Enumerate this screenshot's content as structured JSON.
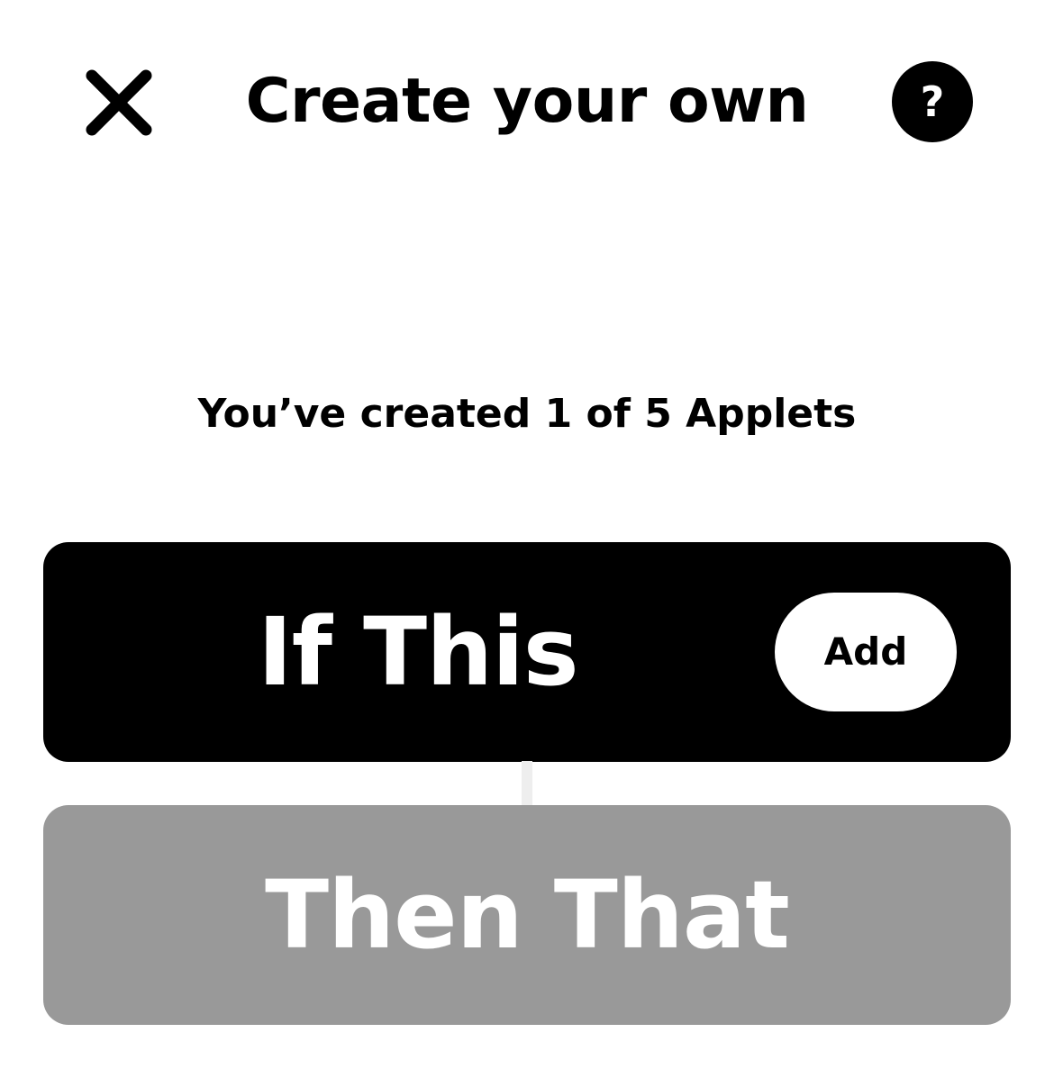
{
  "header": {
    "title": "Create your own",
    "close_icon": "close-icon",
    "help_label": "?",
    "help_icon": "question-mark-icon"
  },
  "applet_count": {
    "text": "You’ve created 1 of 5 Applets",
    "created": 1,
    "limit": 5
  },
  "trigger": {
    "label": "If This",
    "add_label": "Add",
    "color": "#000000"
  },
  "action": {
    "label": "Then That",
    "color": "#999999",
    "state": "disabled"
  },
  "colors": {
    "connector": "#eeeeee",
    "text": "#000000",
    "background": "#ffffff"
  }
}
